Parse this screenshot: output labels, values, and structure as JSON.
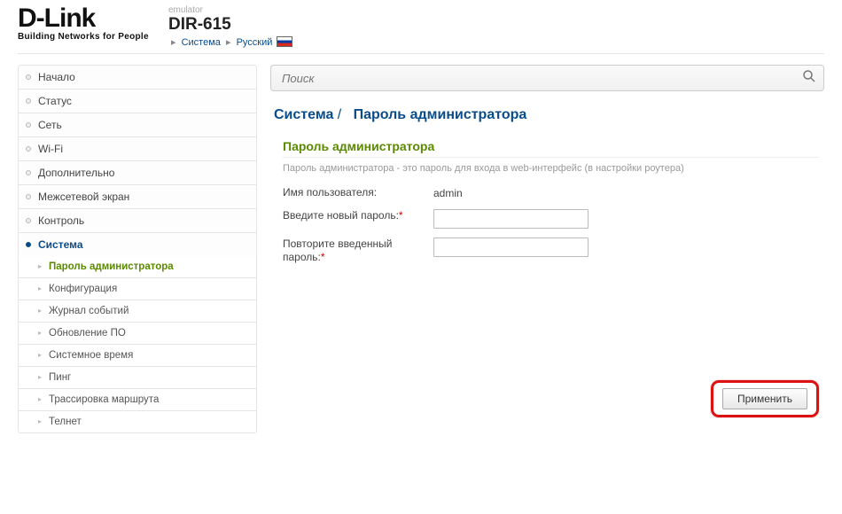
{
  "header": {
    "logo_main": "D-Link",
    "logo_sub": "Building Networks for People",
    "emulator": "emulator",
    "model": "DIR-615",
    "crumb1": "Система",
    "crumb2": "Русский"
  },
  "sidebar": {
    "items": [
      {
        "label": "Начало"
      },
      {
        "label": "Статус"
      },
      {
        "label": "Сеть"
      },
      {
        "label": "Wi-Fi"
      },
      {
        "label": "Дополнительно"
      },
      {
        "label": "Межсетевой экран"
      },
      {
        "label": "Контроль"
      },
      {
        "label": "Система",
        "expanded": true,
        "children": [
          {
            "label": "Пароль администратора",
            "active": true
          },
          {
            "label": "Конфигурация"
          },
          {
            "label": "Журнал событий"
          },
          {
            "label": "Обновление ПО"
          },
          {
            "label": "Системное время"
          },
          {
            "label": "Пинг"
          },
          {
            "label": "Трассировка маршрута"
          },
          {
            "label": "Телнет"
          }
        ]
      }
    ]
  },
  "search": {
    "placeholder": "Поиск"
  },
  "page": {
    "title_section": "Система",
    "title_page": "Пароль администратора",
    "panel_heading": "Пароль администратора",
    "panel_desc": "Пароль администратора - это пароль для входа в web-интерфейс (в настройки роутера)",
    "user_label": "Имя пользователя:",
    "user_value": "admin",
    "pass1_label": "Введите новый пароль:",
    "pass2_label": "Повторите введенный пароль:",
    "apply": "Применить"
  },
  "colors": {
    "accent": "#0a4c8a",
    "green": "#5a8a00",
    "danger": "#d11"
  }
}
